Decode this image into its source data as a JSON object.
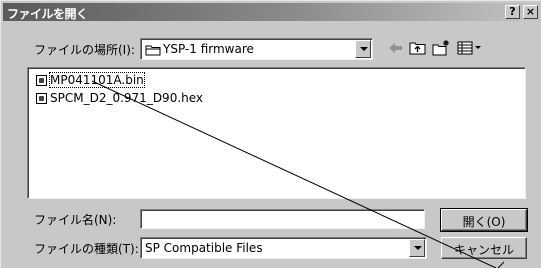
{
  "window": {
    "title": "ファイルを開く"
  },
  "titlebar_buttons": {
    "help": "?",
    "close": "×"
  },
  "location": {
    "label": "ファイルの場所(I):",
    "value": "YSP-1 firmware"
  },
  "files": [
    {
      "name": "MP041101A.bin",
      "selected": true
    },
    {
      "name": "SPCM_D2_0.971_D90.hex",
      "selected": false
    }
  ],
  "filename": {
    "label": "ファイル名(N):",
    "value": ""
  },
  "filetype": {
    "label": "ファイルの種類(T):",
    "value": "SP Compatible Files"
  },
  "buttons": {
    "open": "開く(O)",
    "cancel": "キャンセル"
  },
  "icons": {
    "back": "back-arrow-icon",
    "up": "up-folder-icon",
    "new_folder": "new-folder-icon",
    "view": "view-menu-icon"
  }
}
